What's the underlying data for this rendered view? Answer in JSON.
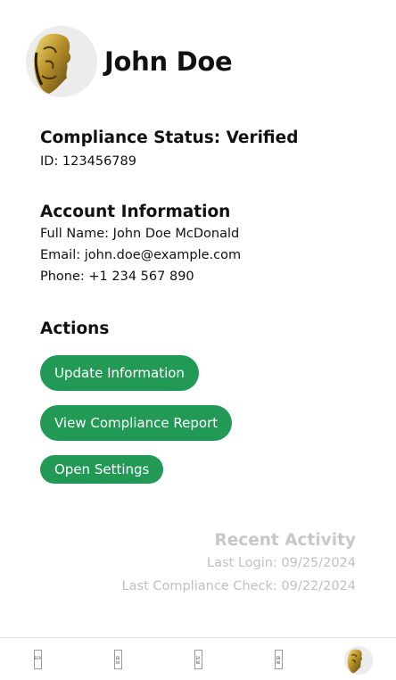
{
  "profile": {
    "name": "John Doe",
    "avatar_icon": "gold-mask-avatar-icon"
  },
  "compliance": {
    "status_label": "Compliance Status: Verified",
    "id_text": "ID: 123456789"
  },
  "account": {
    "heading": "Account Information",
    "full_name": "Full Name: John Doe McDonald",
    "email": "Email: john.doe@example.com",
    "phone": "Phone: +1 234 567 890"
  },
  "actions": {
    "heading": "Actions",
    "update_label": "Update Information",
    "report_label": "View Compliance Report",
    "settings_label": "Open Settings",
    "button_color": "#229954"
  },
  "recent_activity": {
    "heading": "Recent Activity",
    "last_login": "Last Login: 09/25/2024",
    "last_check": "Last Compliance Check: 09/22/2024"
  },
  "bottom_nav": {
    "items": [
      {
        "icon": "missing-glyph-icon",
        "code": "EC84"
      },
      {
        "icon": "missing-glyph-icon",
        "code": "ED A4"
      },
      {
        "icon": "missing-glyph-icon",
        "code": "EA 06"
      },
      {
        "icon": "missing-glyph-icon",
        "code": "EB A6"
      },
      {
        "icon": "profile-avatar-icon"
      }
    ]
  }
}
